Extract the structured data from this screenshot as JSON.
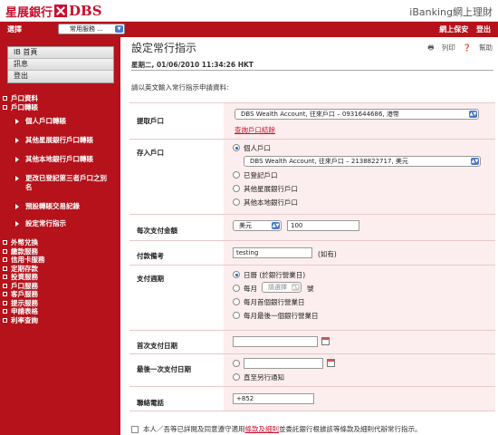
{
  "header": {
    "logo_cn": "星展銀行",
    "logo_en": "DBS",
    "ib_title": "iBanking網上理財"
  },
  "navbar": {
    "select_label": "選擇",
    "select_value": "常用服務 ...",
    "right_items": [
      "網上保安",
      "登出"
    ]
  },
  "sidebar": {
    "top_links": [
      "IB 首頁",
      "訊息",
      "登出"
    ],
    "menu": [
      {
        "label": "戶口資料",
        "subs": []
      },
      {
        "label": "戶口轉賬",
        "subs": [
          "個人戶口轉賬",
          "其他星展銀行戶口轉賬",
          "其他本地銀行戶口轉賬",
          "更改已登記第三者戶口之別名",
          "預設轉賬交易記錄",
          "設定常行指示"
        ]
      },
      {
        "label": "外幣兌換",
        "subs": []
      },
      {
        "label": "繳款服務",
        "subs": []
      },
      {
        "label": "信用卡服務",
        "subs": []
      },
      {
        "label": "定期存款",
        "subs": []
      },
      {
        "label": "投資服務",
        "subs": []
      },
      {
        "label": "戶口服務",
        "subs": []
      },
      {
        "label": "客戶服務",
        "subs": []
      },
      {
        "label": "提示服務",
        "subs": []
      },
      {
        "label": "申請表格",
        "subs": []
      },
      {
        "label": "利率查詢",
        "subs": []
      }
    ]
  },
  "main": {
    "title": "設定常行指示",
    "print_label": "列印",
    "help_label": "幫助",
    "datetime": "星期二, 01/06/2010 11:34:26 HKT",
    "instruction": "請以英文輸入常行指示申請資料:",
    "form": {
      "from_account": {
        "label": "提取戶口",
        "value": "DBS Wealth Account, 往來戶口 – 0931644686, 港幣",
        "link": "查詢戶口結餘"
      },
      "to_account": {
        "label": "存入戶口",
        "options": [
          "個人戶口",
          "已登記戶口",
          "其他星展銀行戶口",
          "其他本地銀行戶口"
        ],
        "selected": "個人戶口",
        "value": "DBS Wealth Account, 往來戶口 – 2138822717, 美元"
      },
      "amount": {
        "label": "每次支付金額",
        "currency": "美元",
        "value": "100"
      },
      "remark": {
        "label": "付款備考",
        "value": "testing",
        "suffix": "(如有)"
      },
      "frequency": {
        "label": "支付週期",
        "option1": "日曆 (於銀行營業日)",
        "option2_prefix": "每月",
        "option2_select": "請選擇",
        "option2_suffix": "號",
        "option3": "每月首個銀行營業日",
        "option4": "每月最後一個銀行營業日"
      },
      "first_date": {
        "label": "首次支付日期",
        "value": ""
      },
      "last_date": {
        "label": "最後一次支付日期",
        "value": "",
        "option_until": "直至另行通知"
      },
      "phone": {
        "label": "聯絡電話",
        "value": "+852"
      }
    },
    "terms": {
      "prefix": "本人／吾等已詳閱及同意遵守適用",
      "link": "條款及細則",
      "suffix": "並委託銀行根據該等條款及細則代辦常行指示。"
    }
  }
}
